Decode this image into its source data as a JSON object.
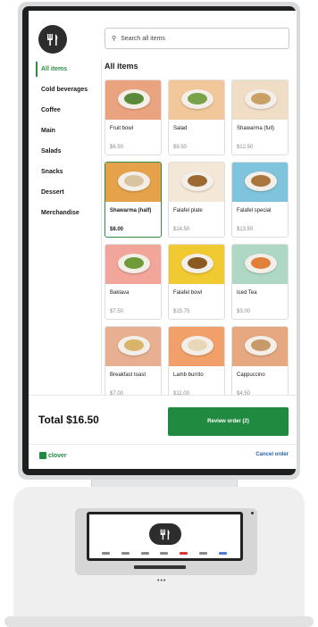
{
  "search": {
    "placeholder": "Search all items"
  },
  "sidebar": {
    "items": [
      {
        "label": "All items",
        "active": true
      },
      {
        "label": "Cold beverages"
      },
      {
        "label": "Coffee"
      },
      {
        "label": "Main"
      },
      {
        "label": "Salads"
      },
      {
        "label": "Snacks"
      },
      {
        "label": "Dessert"
      },
      {
        "label": "Merchandise"
      }
    ]
  },
  "main": {
    "section_title": "All items",
    "products": [
      {
        "name": "Fruit bowl",
        "price": "$6.50",
        "bg": "#e9a37e",
        "food": "#5a8a3a"
      },
      {
        "name": "Salad",
        "price": "$9.50",
        "bg": "#f2c79a",
        "food": "#7aa24a"
      },
      {
        "name": "Shawarma (full)",
        "price": "$12.50",
        "bg": "#f0ddc6",
        "food": "#c9a066"
      },
      {
        "name": "Shawarma (half)",
        "price": "$8.00",
        "bg": "#e6a24a",
        "food": "#d9c4a0",
        "selected": true
      },
      {
        "name": "Falafel plate",
        "price": "$14.50",
        "bg": "#f3e7d7",
        "food": "#9a6a32"
      },
      {
        "name": "Falafel special",
        "price": "$13.50",
        "bg": "#7fc4dc",
        "food": "#a8763a"
      },
      {
        "name": "Baklava",
        "price": "$7.50",
        "bg": "#f2a59a",
        "food": "#6f9a3a"
      },
      {
        "name": "Falafel bowl",
        "price": "$15.75",
        "bg": "#f1c930",
        "food": "#8a5a22"
      },
      {
        "name": "Iced Tea",
        "price": "$3.00",
        "bg": "#aed8c4",
        "food": "#e0803a"
      },
      {
        "name": "Breakfast toast",
        "price": "$7.00",
        "bg": "#e8b090",
        "food": "#d9b36a"
      },
      {
        "name": "Lamb burrito",
        "price": "$11.00",
        "bg": "#f2a06a",
        "food": "#e8d8b8"
      },
      {
        "name": "Cappuccino",
        "price": "$4.50",
        "bg": "#e5a880",
        "food": "#c89a6a"
      }
    ]
  },
  "footer": {
    "total": "Total $16.50",
    "review_label": "Review order (2)",
    "brand": "clover",
    "cancel_label": "Cancel order"
  },
  "colors": {
    "accent": "#1f8a40",
    "link": "#2563a8"
  }
}
